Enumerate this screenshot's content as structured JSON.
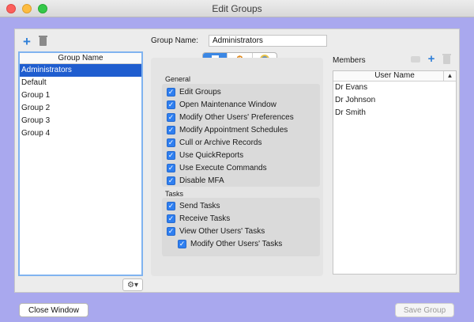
{
  "window": {
    "title": "Edit Groups"
  },
  "groups": {
    "header": "Group Name",
    "items": [
      "Administrators",
      "Default",
      "Group 1",
      "Group 2",
      "Group 3",
      "Group 4"
    ],
    "selected_index": 0
  },
  "group_name": {
    "label": "Group Name:",
    "value": "Administrators"
  },
  "tabs": [
    {
      "icon": "document-icon",
      "active": true
    },
    {
      "icon": "dollar-icon",
      "active": false
    },
    {
      "icon": "person-icon",
      "active": false
    }
  ],
  "permissions": {
    "general_label": "General",
    "general": [
      {
        "label": "Edit Groups",
        "checked": true
      },
      {
        "label": "Open Maintenance Window",
        "checked": true
      },
      {
        "label": "Modify Other Users' Preferences",
        "checked": true
      },
      {
        "label": "Modify Appointment Schedules",
        "checked": true
      },
      {
        "label": "Cull or Archive Records",
        "checked": true
      },
      {
        "label": "Use QuickReports",
        "checked": true
      },
      {
        "label": "Use Execute Commands",
        "checked": true
      },
      {
        "label": "Disable MFA",
        "checked": true
      }
    ],
    "tasks_label": "Tasks",
    "tasks": [
      {
        "label": "Send Tasks",
        "checked": true
      },
      {
        "label": "Receive Tasks",
        "checked": true
      },
      {
        "label": "View Other Users' Tasks",
        "checked": true
      },
      {
        "label": "Modify Other Users' Tasks",
        "checked": true,
        "indent": true
      }
    ]
  },
  "members": {
    "label": "Members",
    "header": "User Name",
    "items": [
      "Dr Evans",
      "Dr Johnson",
      "Dr Smith"
    ]
  },
  "buttons": {
    "close": "Close Window",
    "save": "Save Group"
  }
}
